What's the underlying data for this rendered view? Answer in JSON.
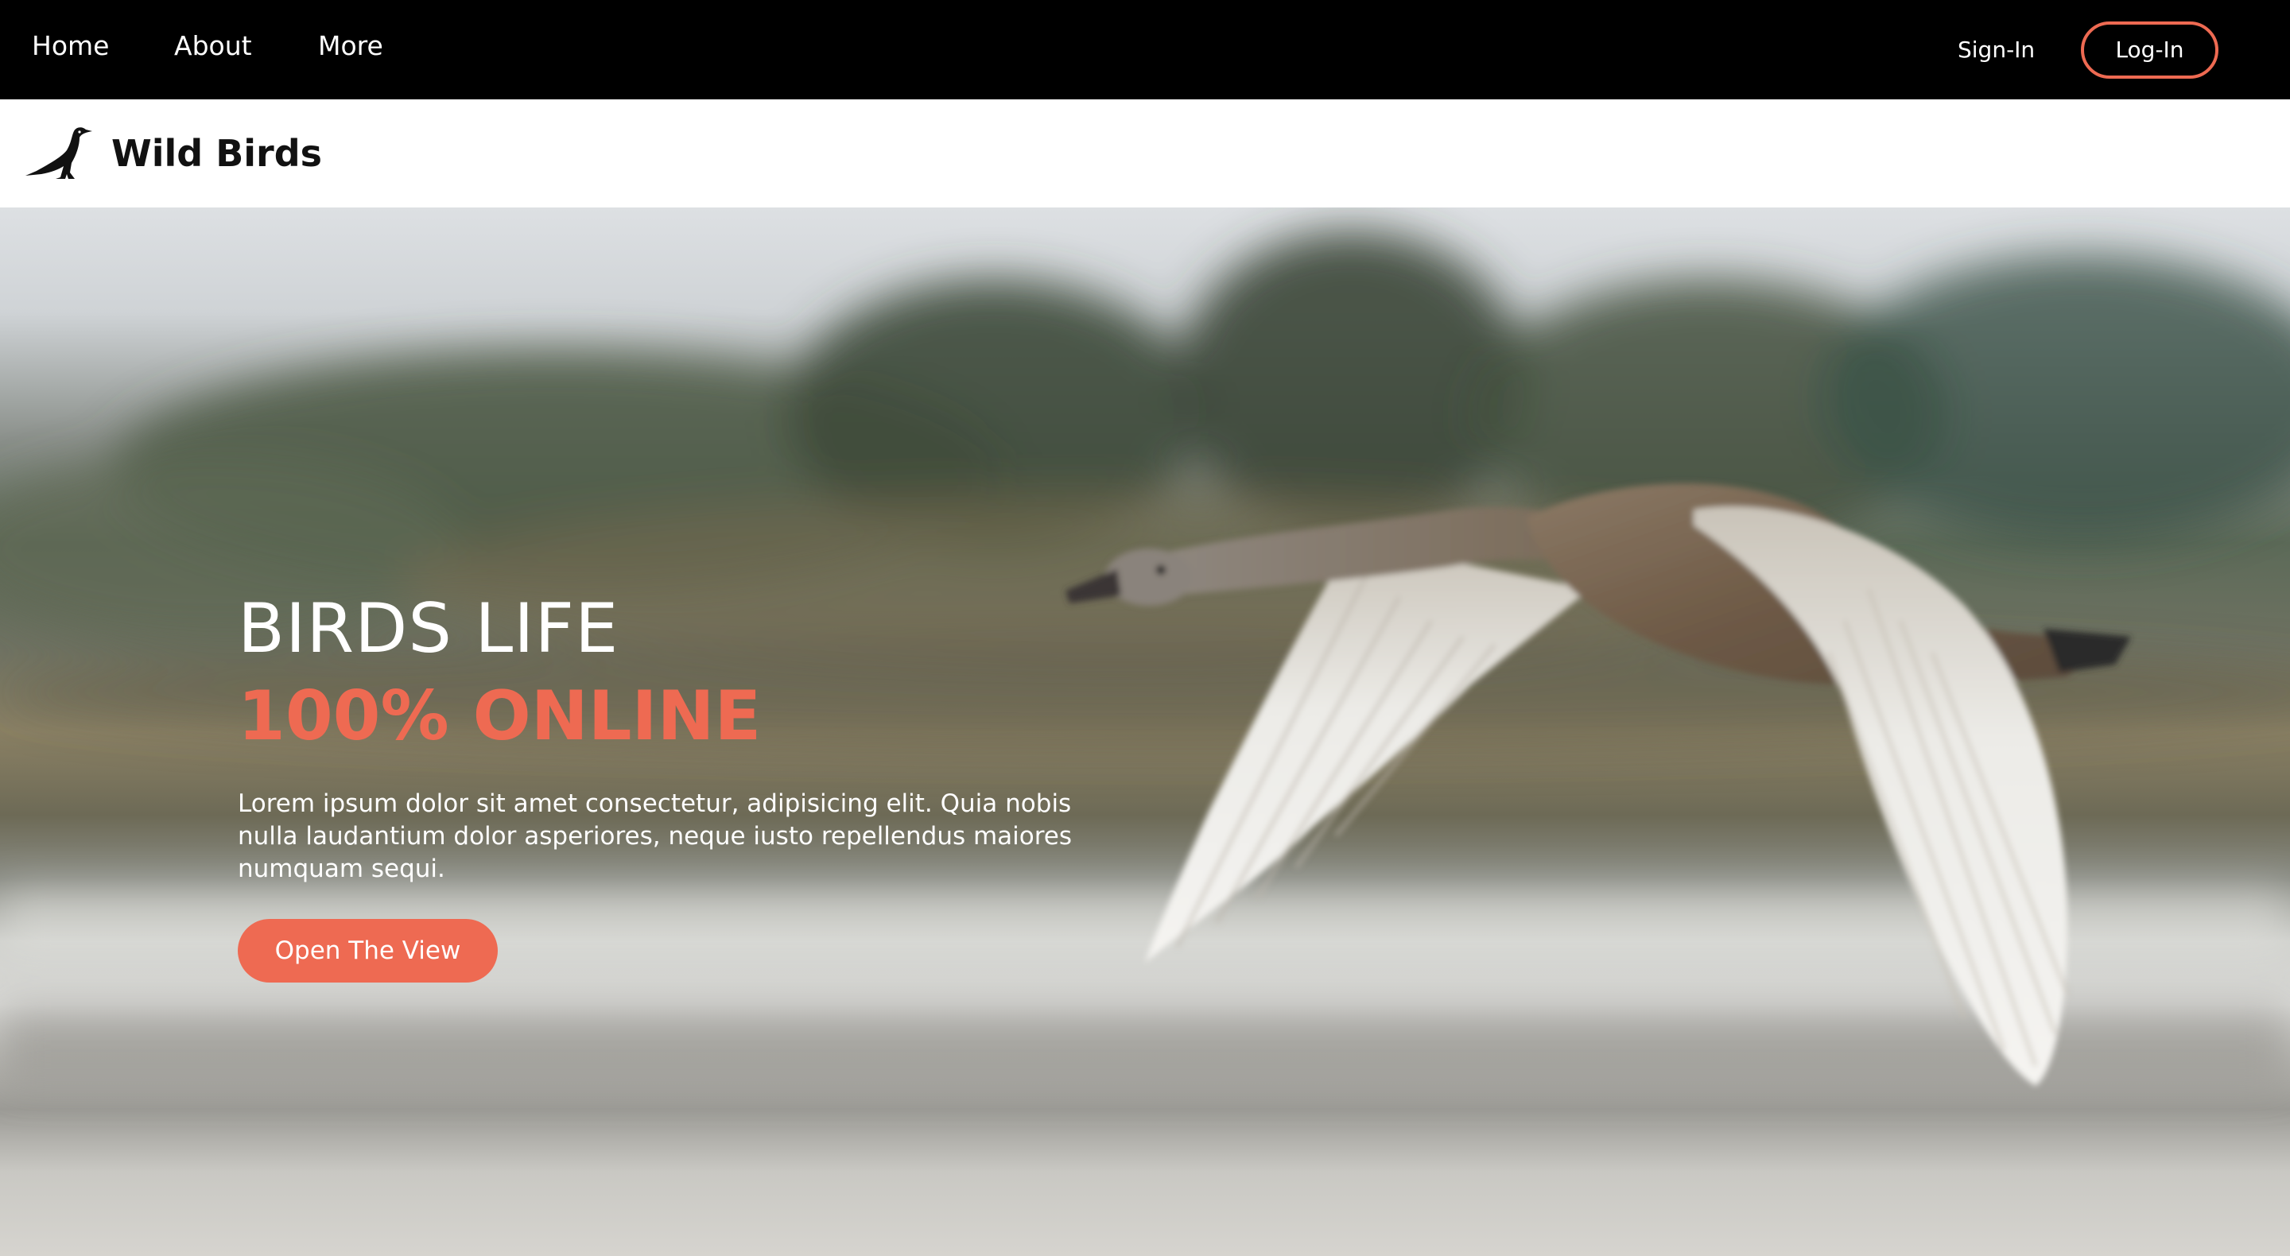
{
  "nav": {
    "home_label": "Home",
    "about_label": "About",
    "more_label": "More",
    "signin_label": "Sign-In",
    "login_label": "Log-In"
  },
  "brand": {
    "name": "Wild Birds",
    "logo_icon": "bird-logo-icon"
  },
  "hero": {
    "title": "BIRDS LIFE",
    "subtitle": "100% ONLINE",
    "text": "Lorem ipsum dolor sit amet consectetur, adipisicing elit. Quia nobis nulla laudantium dolor asperiores, neque iusto repellendus maiores numquam sequi.",
    "button_label": "Open The View",
    "image_subject": "swan-flying-image"
  },
  "colors": {
    "accent": "#ee6a52",
    "topbar": "#000000",
    "brand_text": "#111111",
    "hero_text": "#ffffff"
  }
}
